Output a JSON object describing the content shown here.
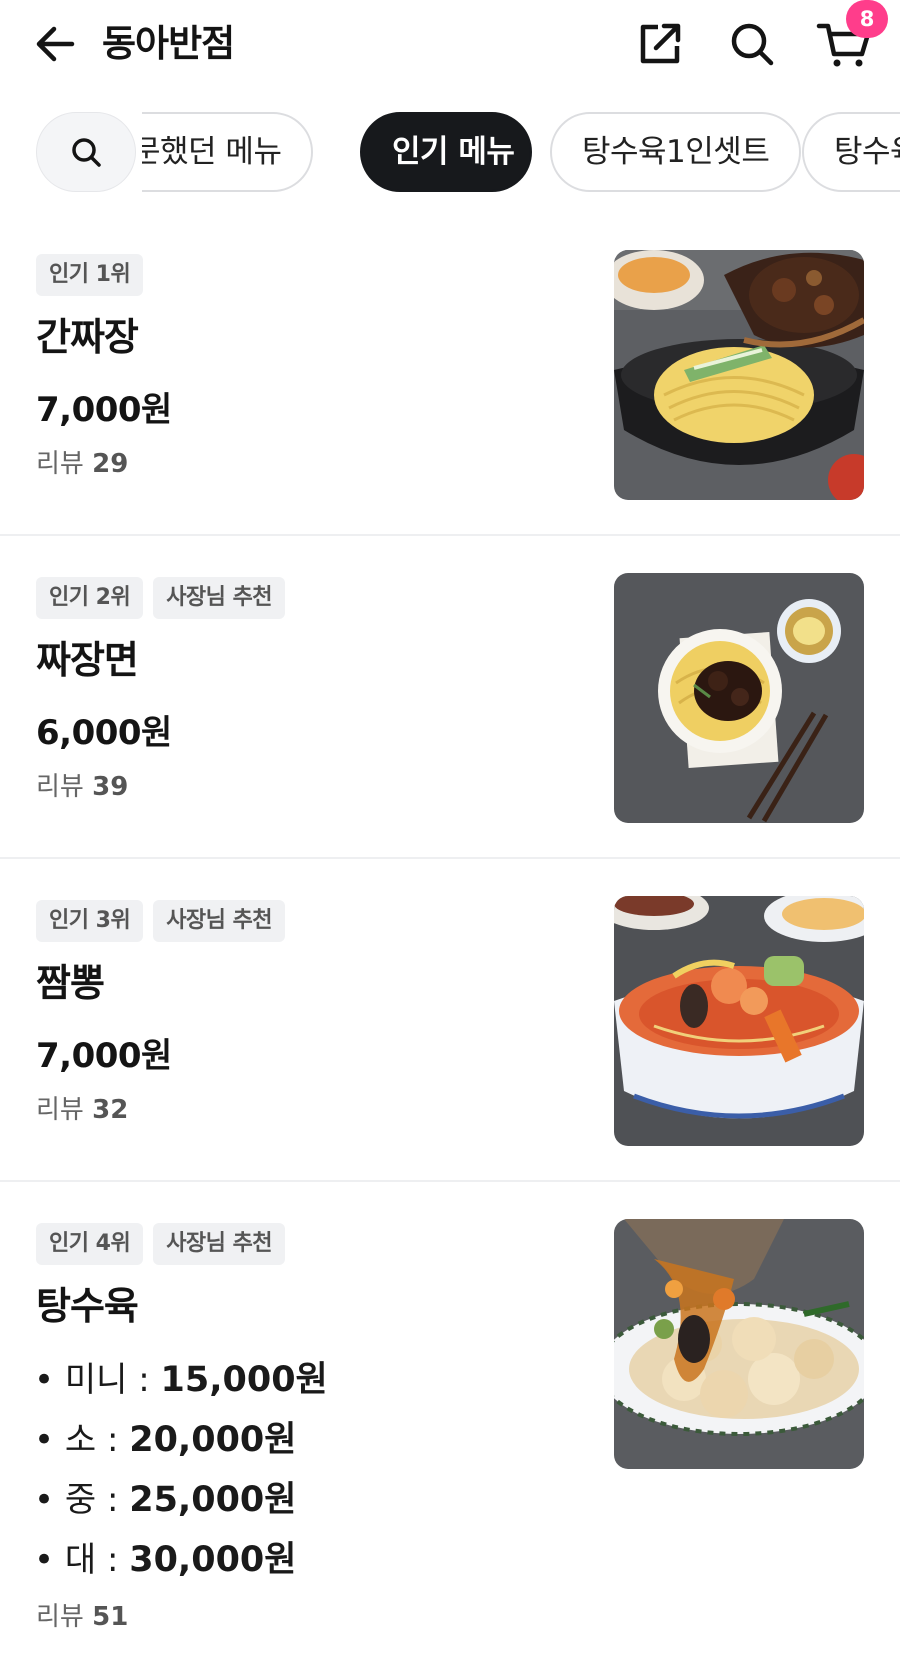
{
  "header": {
    "title": "동아반점",
    "cart_count": "8",
    "icons": [
      "back-arrow-icon",
      "share-icon",
      "search-icon",
      "cart-icon"
    ]
  },
  "chips": {
    "items": [
      {
        "label": "주문했던 메뉴"
      },
      {
        "label": "인기 메뉴",
        "active": true
      },
      {
        "label": "탕수육1인셋트"
      },
      {
        "label": "탕수육"
      }
    ]
  },
  "menu": [
    {
      "badges": [
        "인기 1위"
      ],
      "name": "간짜장",
      "price": "7,000원",
      "review_label": "리뷰",
      "review_count": "29",
      "image": "ganjjajang-photo"
    },
    {
      "badges": [
        "인기 2위",
        "사장님 추천"
      ],
      "name": "짜장면",
      "price": "6,000원",
      "review_label": "리뷰",
      "review_count": "39",
      "image": "jjajangmyeon-photo"
    },
    {
      "badges": [
        "인기 3위",
        "사장님 추천"
      ],
      "name": "짬뽕",
      "price": "7,000원",
      "review_label": "리뷰",
      "review_count": "32",
      "image": "jjamppong-photo"
    },
    {
      "badges": [
        "인기 4위",
        "사장님 추천"
      ],
      "name": "탕수육",
      "options": [
        {
          "label": "• 미니 : ",
          "price": "15,000원"
        },
        {
          "label": "• 소 : ",
          "price": "20,000원"
        },
        {
          "label": "• 중 : ",
          "price": "25,000원"
        },
        {
          "label": "• 대 : ",
          "price": "30,000원"
        }
      ],
      "review_label": "리뷰",
      "review_count": "51",
      "image": "tangsuyuk-photo"
    }
  ],
  "colors": {
    "accent": "#17191c",
    "badge": "#ff3d8b"
  }
}
